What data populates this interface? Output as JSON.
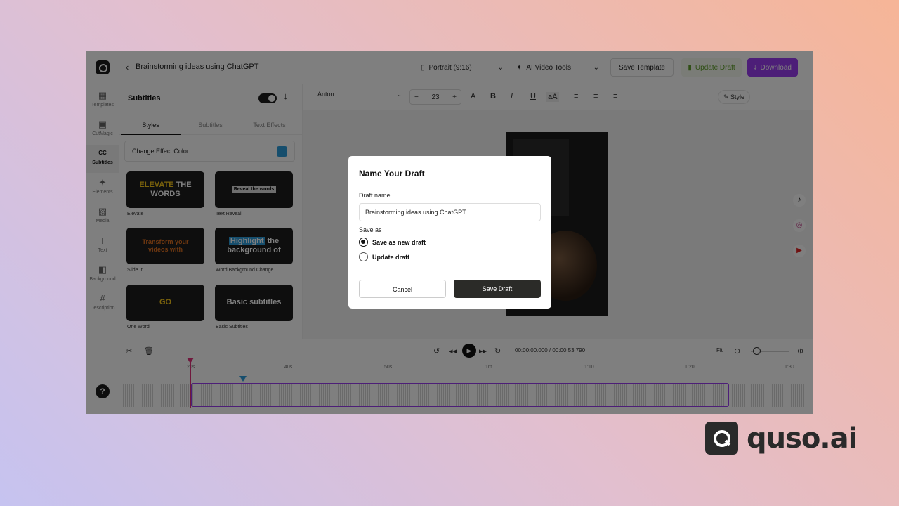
{
  "header": {
    "title": "Brainstorming ideas using ChatGPT",
    "aspect": "Portrait (9:16)",
    "ai_tools": "AI Video Tools",
    "save_template": "Save Template",
    "update_draft": "Update Draft",
    "download": "Download"
  },
  "sidebar": {
    "items": [
      {
        "label": "Templates",
        "icon": "▦"
      },
      {
        "label": "CutMagic",
        "icon": "▣"
      },
      {
        "label": "Subtitles",
        "icon": "CC"
      },
      {
        "label": "Elements",
        "icon": "✦"
      },
      {
        "label": "Media",
        "icon": "▨"
      },
      {
        "label": "Text",
        "icon": "T"
      },
      {
        "label": "Background",
        "icon": "◧"
      },
      {
        "label": "Description",
        "icon": "#"
      }
    ],
    "help": "?"
  },
  "panel": {
    "title": "Subtitles",
    "tabs": [
      "Styles",
      "Subtitles",
      "Text Effects"
    ],
    "effect_color_label": "Change Effect Color",
    "effect_color": "#2d9cdb",
    "cards": [
      {
        "label": "Elevate",
        "line1": "ELEVATE",
        "line1b": "THE",
        "line2": "WORDS"
      },
      {
        "label": "Text Reveal",
        "preview": "Reveal the words"
      },
      {
        "label": "Slide In",
        "preview1": "Transform your",
        "preview2": "videos with"
      },
      {
        "label": "Word Background Change",
        "hl": "Highlight",
        "rest": "the",
        "line2": "background of"
      },
      {
        "label": "One Word",
        "preview": "GO"
      },
      {
        "label": "Basic Subtitles",
        "preview": "Basic subtitles"
      }
    ]
  },
  "toolbar": {
    "font": "Anton",
    "font_size": "23",
    "minus": "−",
    "plus": "+",
    "style": "Style"
  },
  "timeline": {
    "time": "00:00:00.000 / 00:00:53.790",
    "fit": "Fit",
    "ticks": [
      "20s",
      "40s",
      "50s",
      "1m",
      "1:10",
      "1:20",
      "1:30"
    ]
  },
  "modal": {
    "title": "Name Your Draft",
    "name_label": "Draft name",
    "name_value": "Brainstorming ideas using ChatGPT",
    "save_as_label": "Save as",
    "option_new": "Save as new draft",
    "option_update": "Update draft",
    "cancel": "Cancel",
    "save": "Save Draft"
  },
  "brand": {
    "name": "quso.ai"
  },
  "colors": {
    "accent": "#9b3cf0",
    "playhead": "#e0307a"
  }
}
